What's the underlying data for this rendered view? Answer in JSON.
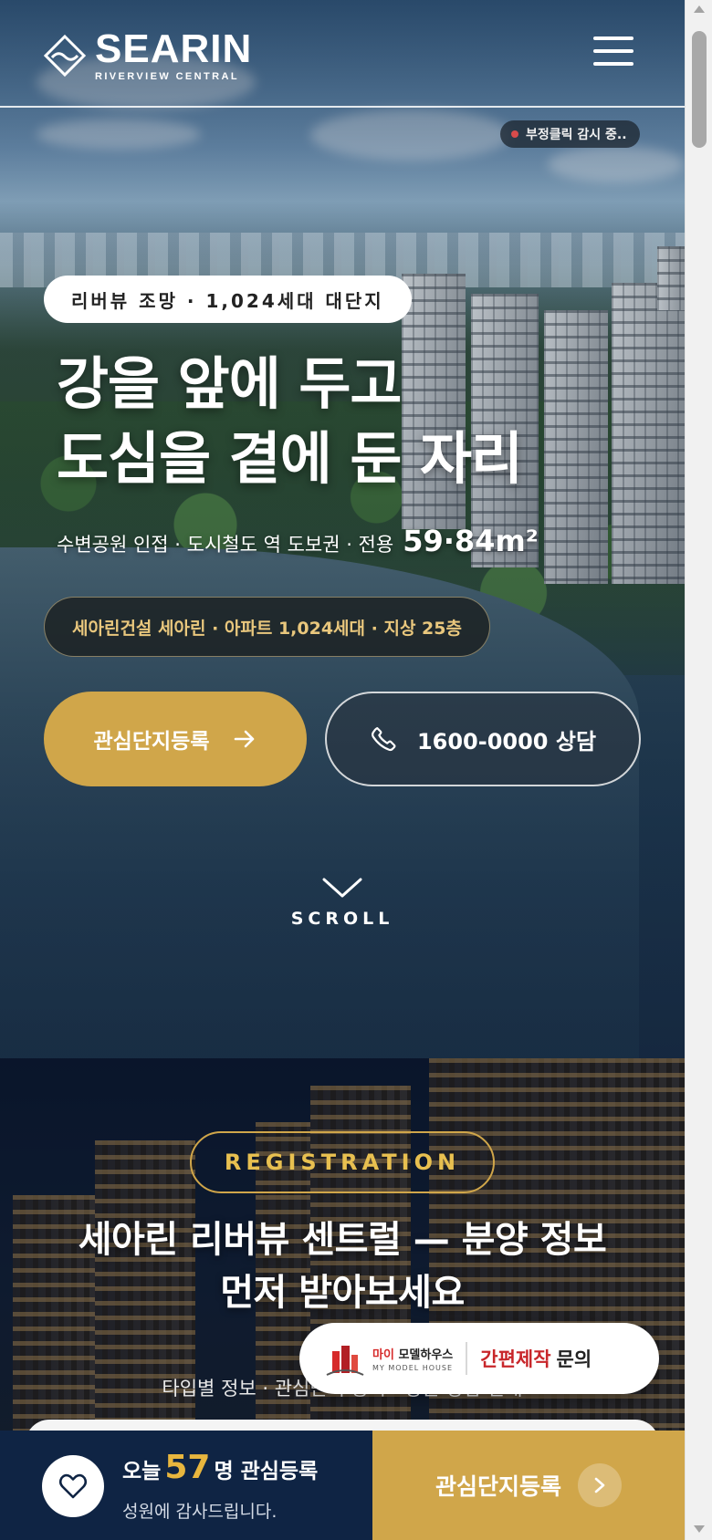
{
  "header": {
    "brand_name": "SEARIN",
    "brand_sub": "RIVERVIEW CENTRAL"
  },
  "hero": {
    "monitor_badge": "부정클릭 감시 중..",
    "tag": "리버뷰 조망 · 1,024세대 대단지",
    "title_line1": "강을 앞에 두고",
    "title_line2": "도심을 곁에 둔 자리",
    "sub_text": "수변공원 인접 · 도시철도 역 도보권 · 전용",
    "sub_area": "59·84m²",
    "info_pill": "세아린건설 세아린 · 아파트 1,024세대 · 지상 25층",
    "register_button": "관심단지등록",
    "call_button": "1600-0000 상담",
    "scroll_label": "SCROLL"
  },
  "registration": {
    "tag": "REGISTRATION",
    "title_line1": "세아린 리버뷰 센트럴 — 분양 정보",
    "title_line2": "먼저 받아보세요",
    "subtitle": "타입별 정보 · 관심단지 등록 · 방문 상담 안내"
  },
  "model_house": {
    "brand_highlight": "마이",
    "brand_rest": "모델하우스",
    "brand_en": "MY MODEL HOUSE",
    "cta_highlight": "간편제작",
    "cta_rest": "문의"
  },
  "bottom_bar": {
    "count_prefix": "오늘",
    "count_value": "57",
    "count_suffix": "명 관심등록",
    "thanks": "성원에 감사드립니다.",
    "register_button": "관심단지등록"
  },
  "colors": {
    "accent_gold": "#d0a64a",
    "navy": "#0f2444",
    "red": "#c8262a"
  },
  "icons": {
    "menu": "hamburger-icon",
    "register_arrow": "arrow-right-icon",
    "call": "phone-icon",
    "scroll": "chevron-down-icon",
    "heart": "heart-icon",
    "bottom_arrow": "chevron-right-icon"
  }
}
